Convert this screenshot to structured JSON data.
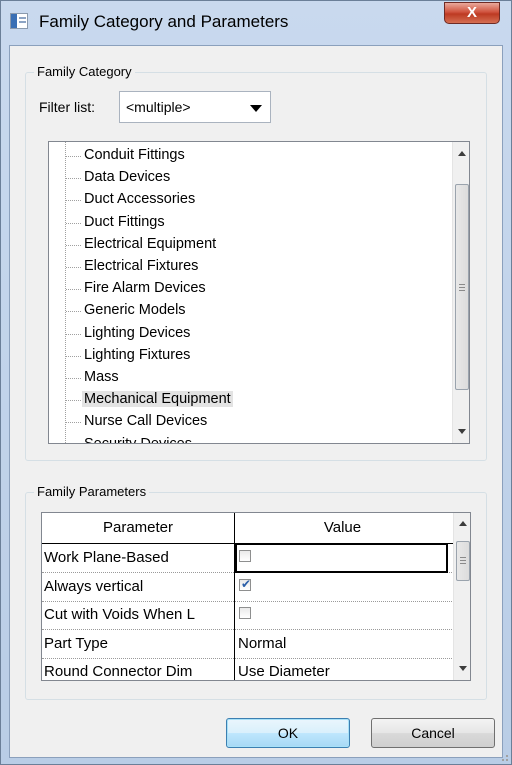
{
  "window": {
    "title": "Family Category and Parameters",
    "close_label": "X"
  },
  "category": {
    "group_label": "Family Category",
    "filter_label": "Filter list:",
    "filter_value": "<multiple>",
    "items": [
      "Conduit Fittings",
      "Data Devices",
      "Duct Accessories",
      "Duct Fittings",
      "Electrical Equipment",
      "Electrical Fixtures",
      "Fire Alarm Devices",
      "Generic Models",
      "Lighting Devices",
      "Lighting Fixtures",
      "Mass",
      "Mechanical Equipment",
      "Nurse Call Devices",
      "Security Devices"
    ],
    "selected_item": "Mechanical Equipment"
  },
  "parameters": {
    "group_label": "Family Parameters",
    "columns": [
      "Parameter",
      "Value"
    ],
    "rows": [
      {
        "name": "Work Plane-Based",
        "type": "checkbox",
        "checked": false,
        "value": ""
      },
      {
        "name": "Always vertical",
        "type": "checkbox",
        "checked": true,
        "value": ""
      },
      {
        "name": "Cut with Voids When L",
        "type": "checkbox",
        "checked": false,
        "value": ""
      },
      {
        "name": "Part Type",
        "type": "text",
        "checked": false,
        "value": "Normal"
      },
      {
        "name": "Round Connector Dim",
        "type": "text",
        "checked": false,
        "value": "Use Diameter"
      }
    ]
  },
  "buttons": {
    "ok": "OK",
    "cancel": "Cancel"
  },
  "colors": {
    "selection": "#e3e3e3",
    "titlebar": "#c9d9ee",
    "close": "#c9432c"
  }
}
